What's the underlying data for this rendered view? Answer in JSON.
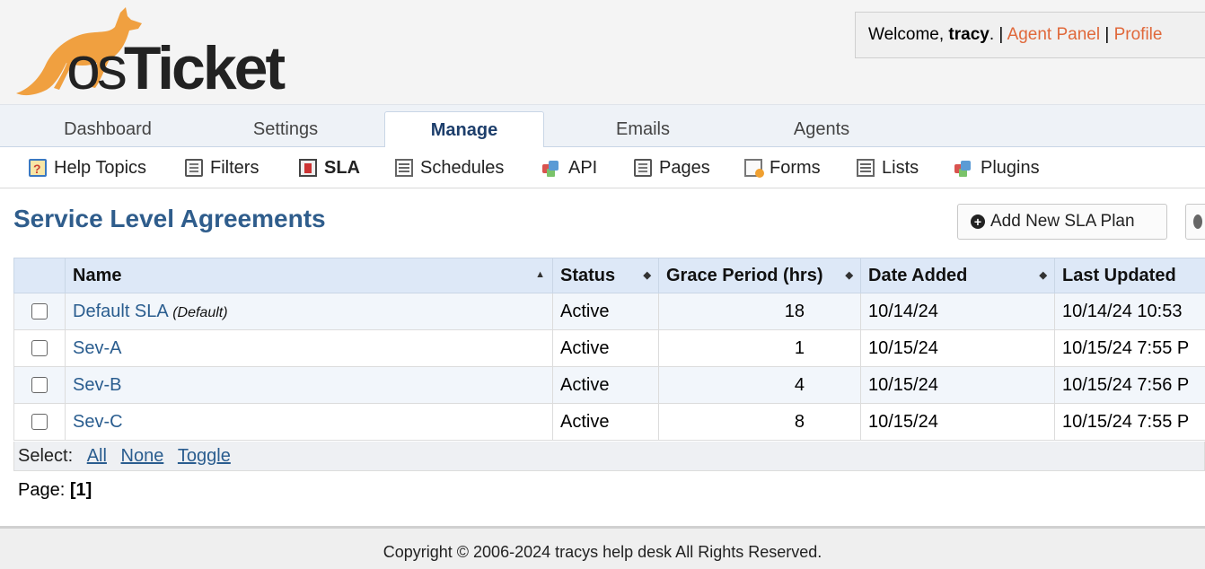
{
  "logo": {
    "text_os": "os",
    "text_ticket": "Ticket"
  },
  "header": {
    "welcome_prefix": "Welcome, ",
    "user": "tracy",
    "welcome_suffix": ". | ",
    "agent_panel": "Agent Panel",
    "sep": " | ",
    "profile": "Profile"
  },
  "nav": {
    "tabs": [
      {
        "label": "Dashboard"
      },
      {
        "label": "Settings"
      },
      {
        "label": "Manage"
      },
      {
        "label": "Emails"
      },
      {
        "label": "Agents"
      }
    ],
    "active_tab": "Manage"
  },
  "subnav": {
    "items": [
      {
        "label": "Help Topics",
        "icon": "help-topics-icon"
      },
      {
        "label": "Filters",
        "icon": "filters-icon"
      },
      {
        "label": "SLA",
        "icon": "sla-icon"
      },
      {
        "label": "Schedules",
        "icon": "schedules-icon"
      },
      {
        "label": "API",
        "icon": "api-icon"
      },
      {
        "label": "Pages",
        "icon": "pages-icon"
      },
      {
        "label": "Forms",
        "icon": "forms-icon"
      },
      {
        "label": "Lists",
        "icon": "lists-icon"
      },
      {
        "label": "Plugins",
        "icon": "plugins-icon"
      }
    ],
    "active_item": "SLA"
  },
  "page": {
    "title": "Service Level Agreements",
    "add_button": "Add New SLA Plan"
  },
  "table": {
    "columns": [
      "Name",
      "Status",
      "Grace Period (hrs)",
      "Date Added",
      "Last Updated"
    ],
    "rows": [
      {
        "name": "Default SLA",
        "tag": "(Default)",
        "status": "Active",
        "grace": "18",
        "added": "10/14/24",
        "updated": "10/14/24 10:53"
      },
      {
        "name": "Sev-A",
        "tag": "",
        "status": "Active",
        "grace": "1",
        "added": "10/15/24",
        "updated": "10/15/24 7:55 P"
      },
      {
        "name": "Sev-B",
        "tag": "",
        "status": "Active",
        "grace": "4",
        "added": "10/15/24",
        "updated": "10/15/24 7:56 P"
      },
      {
        "name": "Sev-C",
        "tag": "",
        "status": "Active",
        "grace": "8",
        "added": "10/15/24",
        "updated": "10/15/24 7:55 P"
      }
    ]
  },
  "select": {
    "label": "Select:",
    "all": "All",
    "none": "None",
    "toggle": "Toggle"
  },
  "pager": {
    "label": "Page:",
    "current": "[1]"
  },
  "footer": {
    "text": "Copyright © 2006-2024 tracys help desk All Rights Reserved."
  },
  "colors": {
    "accent": "#2f5d8c",
    "link": "#2a5d8f",
    "header_link": "#e0683a",
    "logo_orange": "#f0a040"
  }
}
